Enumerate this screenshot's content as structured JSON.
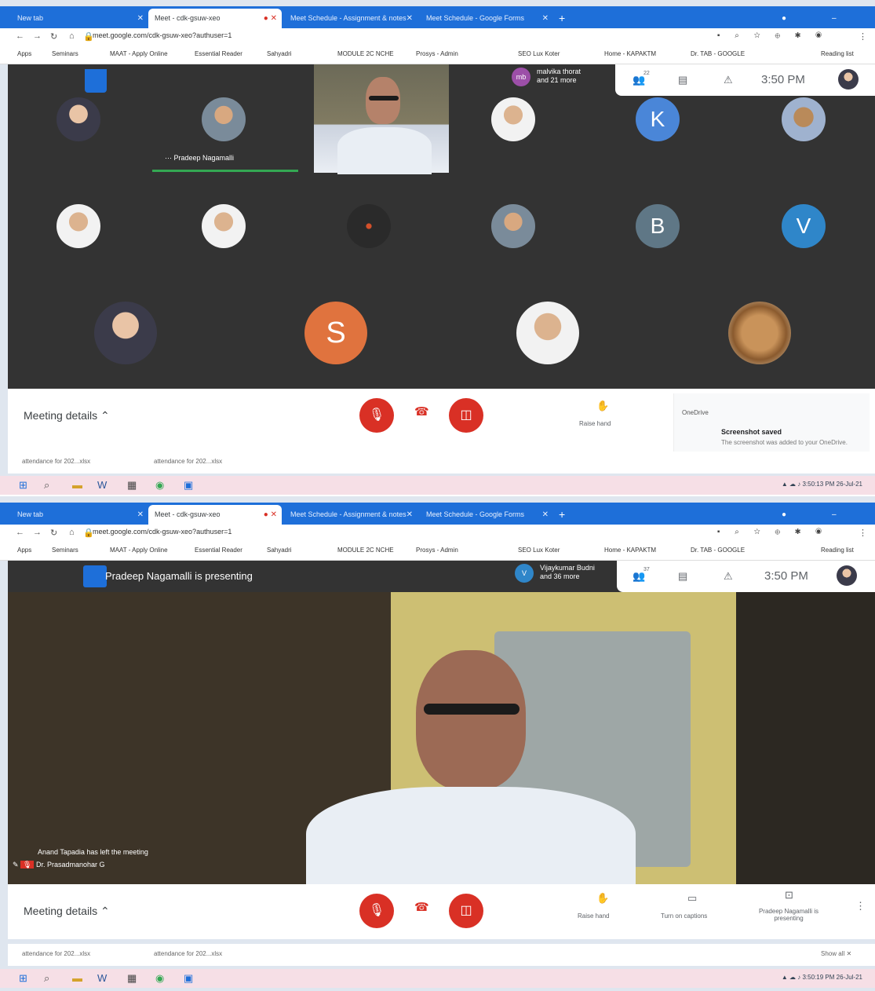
{
  "shot1": {
    "tabs": [
      {
        "label": "New tab"
      },
      {
        "label": "Meet - cdk-gsuw-xeo"
      },
      {
        "label": "Meet Schedule - Assignment & notes"
      },
      {
        "label": "Meet Schedule - Google Forms"
      }
    ],
    "url": "meet.google.com/cdk-gsuw-xeo?authuser=1",
    "bookmarks": [
      "Apps",
      "Seminars",
      "MAAT - Apply Online",
      "Essential Reader",
      "Sahyadri",
      "MODULE 2C NCHE",
      "Prosys - Admin",
      "SEO Lux Koter",
      "Home - KAPAKTM",
      "Dr. TAB - GOOGLE",
      "Reading list"
    ],
    "top_participant": {
      "initial": "mb",
      "name": "malvika thorat",
      "more": "and 21 more"
    },
    "clock": "3:50 PM",
    "participant_count": "22",
    "presenter_name": "Pradeep Nagamalli",
    "letters": [
      "K",
      "B",
      "V",
      "S"
    ],
    "meeting_details": "Meeting details",
    "raise_hand": "Raise hand",
    "toast": {
      "app": "OneDrive",
      "title": "Screenshot saved",
      "body": "The screenshot was added to your OneDrive."
    },
    "downloads": [
      "attendance for 202...xlsx",
      "attendance for 202...xlsx"
    ],
    "tray_time": "3:50:13 PM",
    "tray_date": "26-Jul-21"
  },
  "shot2": {
    "tabs": [
      {
        "label": "New tab"
      },
      {
        "label": "Meet - cdk-gsuw-xeo"
      },
      {
        "label": "Meet Schedule - Assignment & notes"
      },
      {
        "label": "Meet Schedule - Google Forms"
      }
    ],
    "url": "meet.google.com/cdk-gsuw-xeo?authuser=1",
    "bookmarks": [
      "Apps",
      "Seminars",
      "MAAT - Apply Online",
      "Essential Reader",
      "Sahyadri",
      "MODULE 2C NCHE",
      "Prosys - Admin",
      "SEO Lux Koter",
      "Home - KAPAKTM",
      "Dr. TAB - GOOGLE",
      "Reading list"
    ],
    "presenting_banner": "Pradeep Nagamalli is presenting",
    "top_participant": {
      "initial": "V",
      "name": "Vijaykumar Budni",
      "more": "and 36 more"
    },
    "clock": "3:50 PM",
    "participant_count": "37",
    "left_notice": "Anand Tapadia has left the meeting",
    "speaker_name": "Dr. Prasadmanohar G",
    "meeting_details": "Meeting details",
    "raise_hand": "Raise hand",
    "captions": "Turn on captions",
    "presenting_btn": "Pradeep Nagamalli is presenting",
    "show_all": "Show all",
    "downloads": [
      "attendance for 202...xlsx",
      "attendance for 202...xlsx"
    ],
    "tray_time": "3:50:19 PM",
    "tray_date": "26-Jul-21"
  },
  "colors": {
    "tabbar": "#1e6fd9",
    "stage": "#333333",
    "red": "#d93025",
    "K": "#4a86d8",
    "B": "#5f7786",
    "V": "#2f86c9",
    "S": "#e0733e",
    "green": "#34a853"
  }
}
